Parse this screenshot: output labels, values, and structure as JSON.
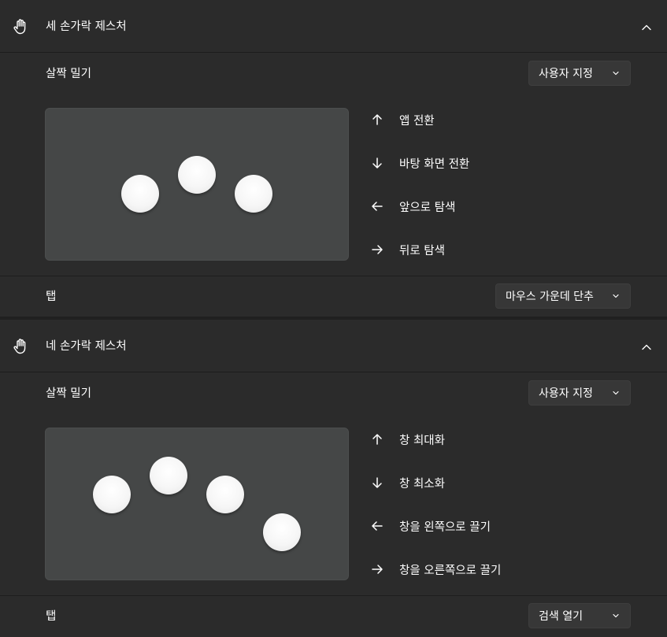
{
  "three_finger": {
    "title": "세 손가락 제스처",
    "swipe": {
      "label": "살짝 밀기",
      "dropdown_value": "사용자 지정",
      "actions": {
        "up": "앱 전환",
        "down": "바탕 화면 전환",
        "left": "앞으로 탐색",
        "right": "뒤로 탐색"
      }
    },
    "tap": {
      "label": "탭",
      "dropdown_value": "마우스 가운데 단추"
    }
  },
  "four_finger": {
    "title": "네 손가락 제스처",
    "swipe": {
      "label": "살짝 밀기",
      "dropdown_value": "사용자 지정",
      "actions": {
        "up": "창 최대화",
        "down": "창 최소화",
        "left": "창을 왼쪽으로 끌기",
        "right": "창을 오른쪽으로 끌기"
      }
    },
    "tap": {
      "label": "탭",
      "dropdown_value": "검색 열기"
    }
  },
  "icons": {
    "section_icon": "hand-icon",
    "collapse": "chevron-up-icon",
    "dropdown": "chevron-down-icon",
    "arrows": [
      "arrow-up-icon",
      "arrow-down-icon",
      "arrow-left-icon",
      "arrow-right-icon"
    ]
  },
  "colors": {
    "background": "#202020",
    "card": "#2b2b2b",
    "preview": "#454747",
    "dropdown": "#373737",
    "text": "#ffffff"
  }
}
